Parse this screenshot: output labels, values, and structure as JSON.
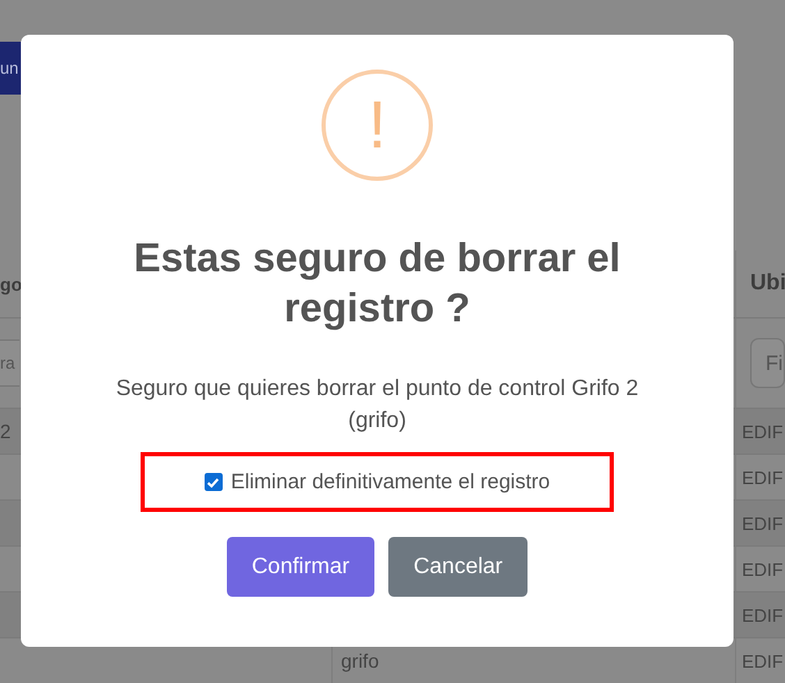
{
  "background": {
    "button": "un",
    "table": {
      "columns": [
        "go",
        "Ubi"
      ],
      "filters": [
        "ra",
        "Fi"
      ],
      "rows": [
        {
          "column_1": "2",
          "column_3": "EDIF"
        },
        {
          "column_3": "EDIF"
        },
        {
          "column_3": "EDIF"
        },
        {
          "column_3": "EDIF"
        },
        {
          "column_3": "EDIF"
        },
        {
          "column_2": "grifo",
          "column_3": "EDIF"
        }
      ]
    }
  },
  "dialog": {
    "icon": "!",
    "title": "Estas seguro de borrar el registro ?",
    "message": "Seguro que quieres borrar el punto de control Grifo 2 (grifo)",
    "checkbox": {
      "label": "Eliminar definitivamente el registro",
      "checked": true,
      "highlighted": true
    },
    "buttons": [
      {
        "label": "Confirmar",
        "kind": "confirm"
      },
      {
        "label": "Cancelar",
        "kind": "cancel"
      }
    ]
  }
}
